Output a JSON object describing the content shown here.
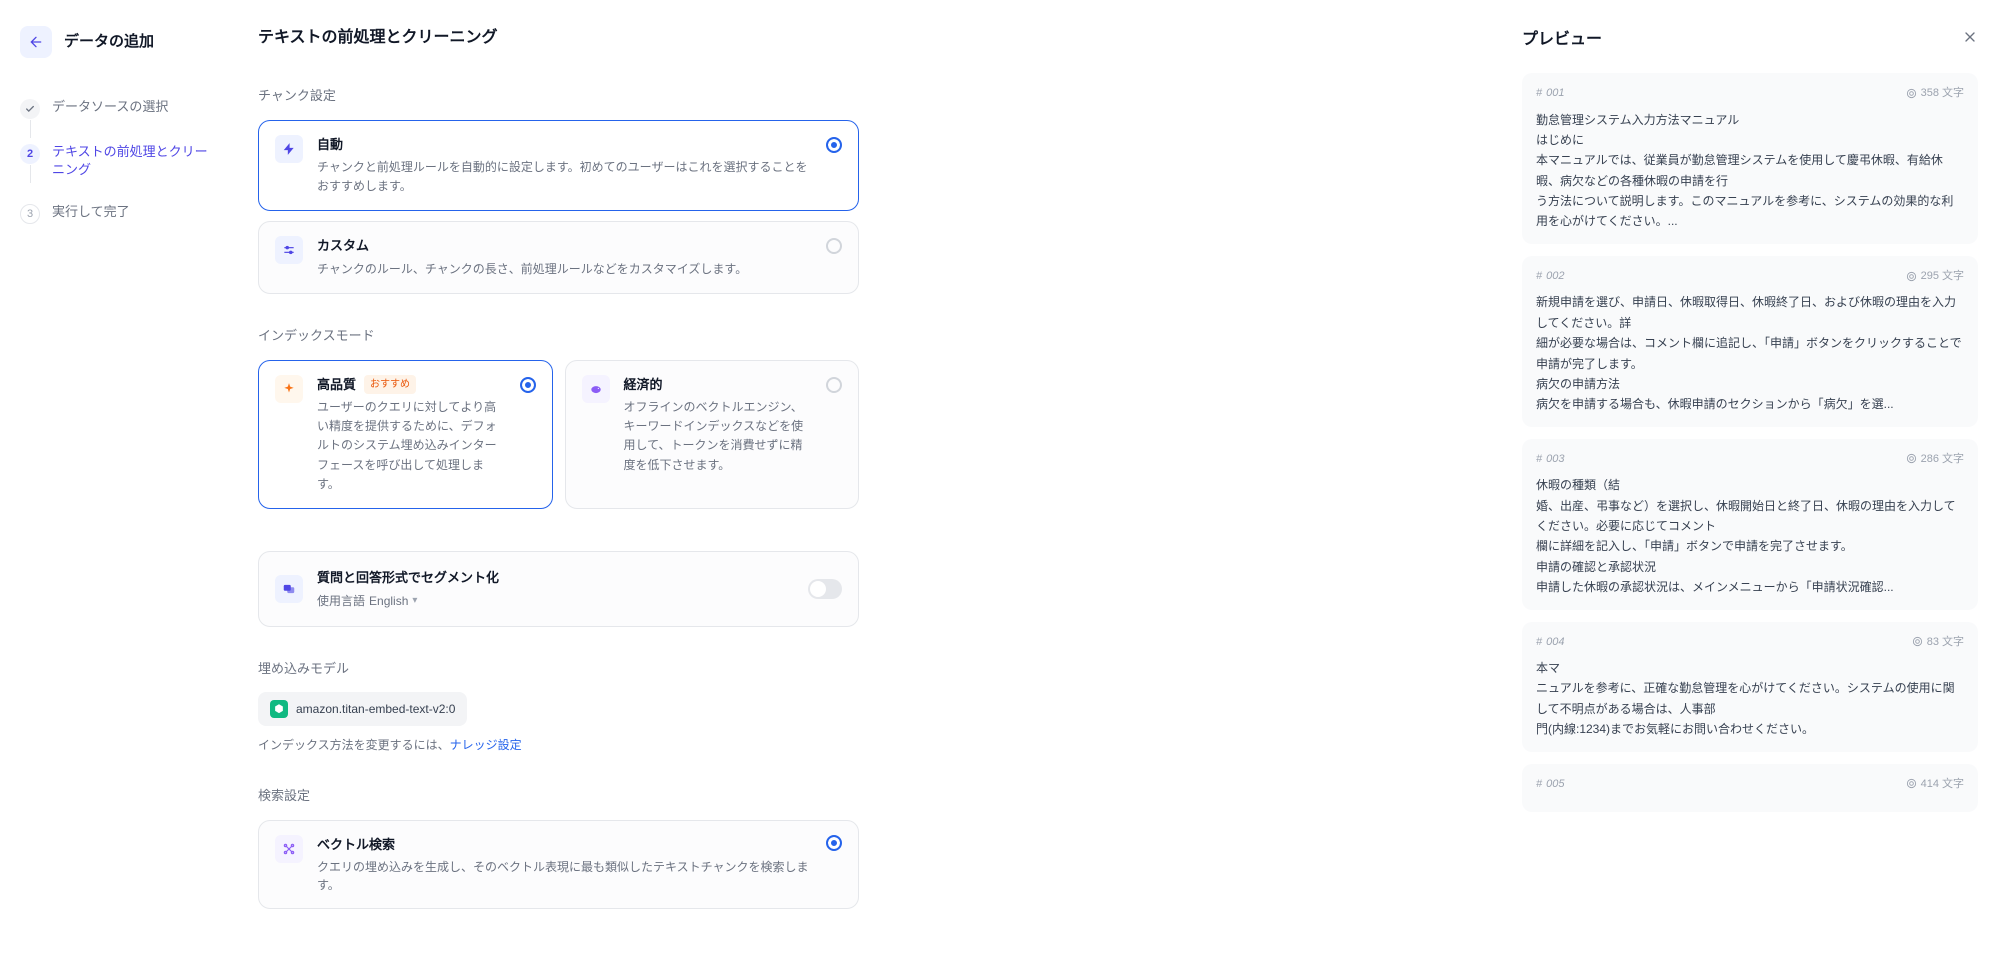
{
  "header": {
    "back_title": "データの追加"
  },
  "steps": [
    {
      "label": "データソースの選択",
      "state": "done"
    },
    {
      "label": "テキストの前処理とクリーニング",
      "state": "active",
      "num": "2"
    },
    {
      "label": "実行して完了",
      "state": "pending",
      "num": "3"
    }
  ],
  "page_title": "テキストの前処理とクリーニング",
  "chunk_settings": {
    "label": "チャンク設定",
    "auto": {
      "title": "自動",
      "desc": "チャンクと前処理ルールを自動的に設定します。初めてのユーザーはこれを選択することをおすすめします。"
    },
    "custom": {
      "title": "カスタム",
      "desc": "チャンクのルール、チャンクの長さ、前処理ルールなどをカスタマイズします。"
    }
  },
  "index_mode": {
    "label": "インデックスモード",
    "high_quality": {
      "title": "高品質",
      "badge": "おすすめ",
      "desc": "ユーザーのクエリに対してより高い精度を提供するために、デフォルトのシステム埋め込みインターフェースを呼び出して処理します。"
    },
    "economical": {
      "title": "経済的",
      "desc": "オフラインのベクトルエンジン、キーワードインデックスなどを使用して、トークンを消費せずに精度を低下させます。"
    }
  },
  "qa_segment": {
    "title": "質問と回答形式でセグメント化",
    "sub_prefix": "使用言語",
    "sub_lang": "English"
  },
  "embedding": {
    "label": "埋め込みモデル",
    "model": "amazon.titan-embed-text-v2:0",
    "note_prefix": "インデックス方法を変更するには、",
    "note_link": "ナレッジ設定"
  },
  "search": {
    "label": "検索設定",
    "vector": {
      "title": "ベクトル検索",
      "desc": "クエリの埋め込みを生成し、そのベクトル表現に最も類似したテキストチャンクを検索します。"
    }
  },
  "preview": {
    "title": "プレビュー",
    "char_suffix": "文字",
    "chunks": [
      {
        "id": "001",
        "chars": "358",
        "text": "勤怠管理システム入力方法マニュアル\nはじめに\n本マニュアルでは、従業員が勤怠管理システムを使用して慶弔休暇、有給休暇、病欠などの各種休暇の申請を行\nう方法について説明します。このマニュアルを参考に、システムの効果的な利用を心がけてください。..."
      },
      {
        "id": "002",
        "chars": "295",
        "text": "新規申請を選び、申請日、休暇取得日、休暇終了日、および休暇の理由を入力してください。詳\n細が必要な場合は、コメント欄に追記し、「申請」ボタンをクリックすることで申請が完了します。\n病欠の申請方法\n病欠を申請する場合も、休暇申請のセクションから「病欠」を選..."
      },
      {
        "id": "003",
        "chars": "286",
        "text": "休暇の種類（結\n婚、出産、弔事など）を選択し、休暇開始日と終了日、休暇の理由を入力してください。必要に応じてコメント\n欄に詳細を記入し、「申請」ボタンで申請を完了させます。\n申請の確認と承認状況\n申請した休暇の承認状況は、メインメニューから「申請状況確認..."
      },
      {
        "id": "004",
        "chars": "83",
        "text": "本マ\nニュアルを参考に、正確な勤怠管理を心がけてください。システムの使用に関して不明点がある場合は、人事部\n門(内線:1234)までお気軽にお問い合わせください。"
      },
      {
        "id": "005",
        "chars": "414",
        "text": ""
      }
    ]
  }
}
